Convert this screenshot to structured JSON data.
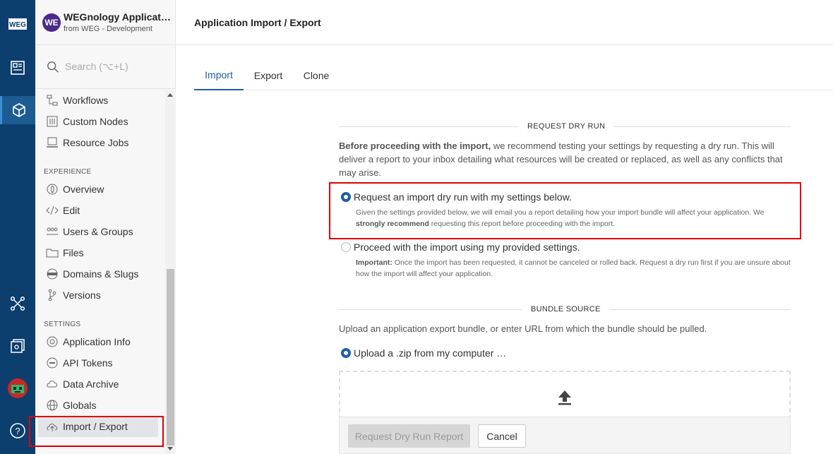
{
  "app": {
    "avatar": "WE",
    "name": "WEGnology Applicati…",
    "sub": "from WEG - Development"
  },
  "search": {
    "placeholder": "Search (⌥+L)"
  },
  "nav": {
    "workflows": "Workflows",
    "custom_nodes": "Custom Nodes",
    "resource_jobs": "Resource Jobs",
    "experience_section": "EXPERIENCE",
    "overview": "Overview",
    "edit": "Edit",
    "users_groups": "Users & Groups",
    "files": "Files",
    "domains_slugs": "Domains & Slugs",
    "versions": "Versions",
    "settings_section": "SETTINGS",
    "application_info": "Application Info",
    "api_tokens": "API Tokens",
    "data_archive": "Data Archive",
    "globals": "Globals",
    "import_export": "Import / Export"
  },
  "page": {
    "title": "Application Import / Export"
  },
  "tabs": [
    {
      "label": "Import"
    },
    {
      "label": "Export"
    },
    {
      "label": "Clone"
    }
  ],
  "dry_run": {
    "section_label": "REQUEST DRY RUN",
    "intro_bold": "Before proceeding with the import,",
    "intro_rest": " we recommend testing your settings by requesting a dry run. This will deliver a report to your inbox detailing what resources will be created or replaced, as well as any conflicts that may arise.",
    "option1_label": "Request an import dry run with my settings below.",
    "option1_help_a": "Given the settings provided below, we will email you a report detailing how your import bundle will affect your application. We ",
    "option1_help_bold": "strongly recommend",
    "option1_help_b": " requesting this report before proceeding with the import.",
    "option2_label": "Proceed with the import using my provided settings.",
    "option2_help_bold": "Important:",
    "option2_help_rest": " Once the import has been requested, it cannot be canceled or rolled back. Request a dry run first if you are unsure about how the import will affect your application."
  },
  "bundle": {
    "section_label": "BUNDLE SOURCE",
    "intro": "Upload an application export bundle, or enter URL from which the bundle should be pulled.",
    "upload_label": "Upload a .zip from my computer …"
  },
  "footer": {
    "primary": "Request Dry Run Report",
    "secondary": "Cancel"
  },
  "colors": {
    "rail": "#0c3e6e",
    "accent": "#1d5ea8",
    "highlight": "#e00000"
  }
}
